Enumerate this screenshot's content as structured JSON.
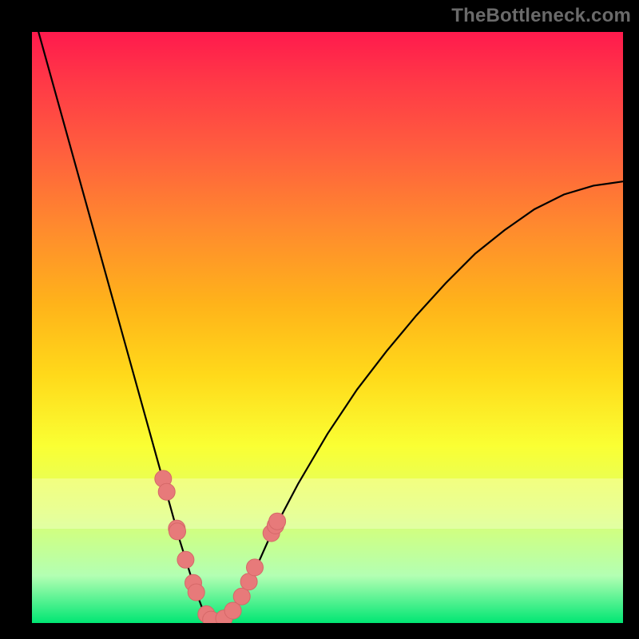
{
  "watermark": "TheBottleneck.com",
  "chart_data": {
    "type": "line",
    "title": "",
    "xlabel": "",
    "ylabel": "",
    "xlim": [
      0,
      1
    ],
    "ylim": [
      0,
      1
    ],
    "series": [
      {
        "name": "bottleneck-curve",
        "x": [
          0.0,
          0.05,
          0.1,
          0.15,
          0.2,
          0.225,
          0.25,
          0.275,
          0.29,
          0.3,
          0.32,
          0.34,
          0.36,
          0.38,
          0.4,
          0.45,
          0.5,
          0.55,
          0.6,
          0.65,
          0.7,
          0.75,
          0.8,
          0.85,
          0.9,
          0.95,
          1.0
        ],
        "y": [
          1.04,
          0.86,
          0.68,
          0.5,
          0.32,
          0.23,
          0.14,
          0.06,
          0.02,
          0.005,
          0.005,
          0.02,
          0.055,
          0.095,
          0.14,
          0.235,
          0.32,
          0.395,
          0.46,
          0.52,
          0.575,
          0.625,
          0.665,
          0.7,
          0.725,
          0.74,
          0.747
        ]
      }
    ],
    "markers": {
      "name": "highlight-dots",
      "x": [
        0.222,
        0.228,
        0.245,
        0.246,
        0.26,
        0.273,
        0.278,
        0.295,
        0.303,
        0.325,
        0.34,
        0.355,
        0.367,
        0.377,
        0.405,
        0.412,
        0.415
      ],
      "y": [
        0.244,
        0.222,
        0.16,
        0.155,
        0.107,
        0.068,
        0.052,
        0.015,
        0.006,
        0.008,
        0.021,
        0.045,
        0.07,
        0.094,
        0.152,
        0.165,
        0.172
      ]
    },
    "gradient_stops": [
      {
        "pos": 0.0,
        "color": "#ff1a4d"
      },
      {
        "pos": 0.08,
        "color": "#ff3747"
      },
      {
        "pos": 0.2,
        "color": "#ff5e3e"
      },
      {
        "pos": 0.33,
        "color": "#ff8a2e"
      },
      {
        "pos": 0.46,
        "color": "#ffb31a"
      },
      {
        "pos": 0.58,
        "color": "#ffd91a"
      },
      {
        "pos": 0.7,
        "color": "#faff33"
      },
      {
        "pos": 0.8,
        "color": "#e0ff66"
      },
      {
        "pos": 0.92,
        "color": "#b3ffb3"
      },
      {
        "pos": 1.0,
        "color": "#00e673"
      }
    ],
    "glow_band": {
      "top_frac": 0.755,
      "height_frac": 0.085
    },
    "colors": {
      "curve": "#000000",
      "marker_fill": "#e77a7a",
      "marker_stroke": "#d56868",
      "frame": "#000000"
    }
  }
}
